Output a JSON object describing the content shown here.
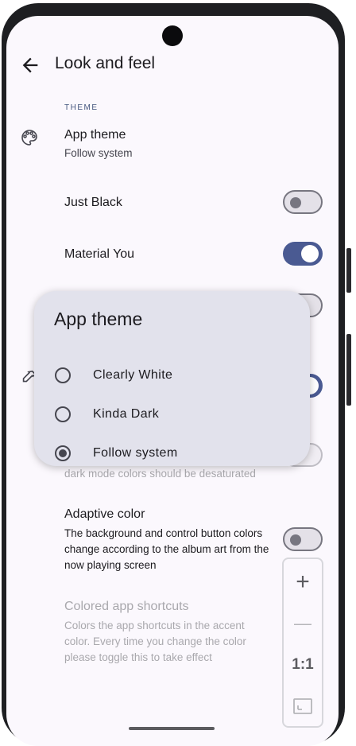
{
  "topbar": {
    "title": "Look and feel"
  },
  "section": {
    "theme_label": "THEME"
  },
  "prefs": {
    "app_theme": {
      "title": "App theme",
      "subtitle": "Follow system"
    },
    "just_black": {
      "title": "Just Black",
      "checked": false
    },
    "material_you": {
      "title": "Material You",
      "checked": true
    },
    "desaturated": {
      "subtitle_partial": "dark mode colors should be desaturated"
    },
    "adaptive_color": {
      "title": "Adaptive color",
      "subtitle": "The background and control button colors change according to the album art from the now playing screen",
      "checked": false
    },
    "colored_shortcuts": {
      "title": "Colored app shortcuts",
      "subtitle": "Colors the app shortcuts in the accent color. Every time you change the color please toggle this to take effect"
    }
  },
  "dialog": {
    "title": "App theme",
    "options": [
      {
        "label": "Clearly White",
        "selected": false
      },
      {
        "label": "Kinda Dark",
        "selected": false
      },
      {
        "label": "Follow system",
        "selected": true
      }
    ]
  },
  "zoom_controls": {
    "plus": "+",
    "minus": "—",
    "one_to_one": "1:1"
  },
  "colors": {
    "accent": "#4a5a92",
    "dialog_bg": "#e2e2ec",
    "screen_bg": "#fbf8fd"
  }
}
